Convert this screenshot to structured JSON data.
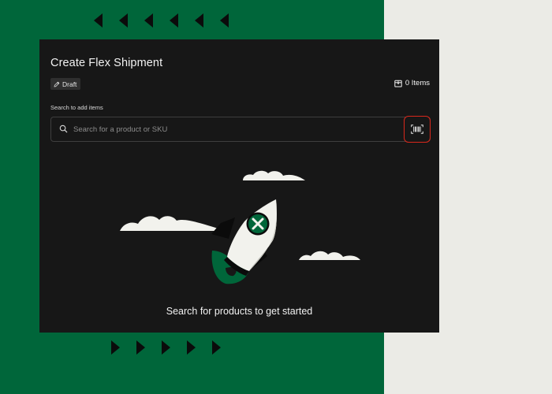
{
  "panel": {
    "title": "Create Flex Shipment",
    "status_badge": "Draft",
    "items_count": "0 Items"
  },
  "search": {
    "label": "Search to add items",
    "placeholder": "Search for a product or SKU",
    "value": ""
  },
  "empty_state": {
    "message": "Search for products to get started"
  },
  "icons": {
    "badge": "pencil-icon",
    "items": "box-icon",
    "search": "search-icon",
    "scan": "barcode-icon"
  },
  "colors": {
    "brand_green": "#00663a",
    "panel_bg": "#171717",
    "highlight_red": "#d9281c",
    "side_bg": "#ebebe6"
  }
}
